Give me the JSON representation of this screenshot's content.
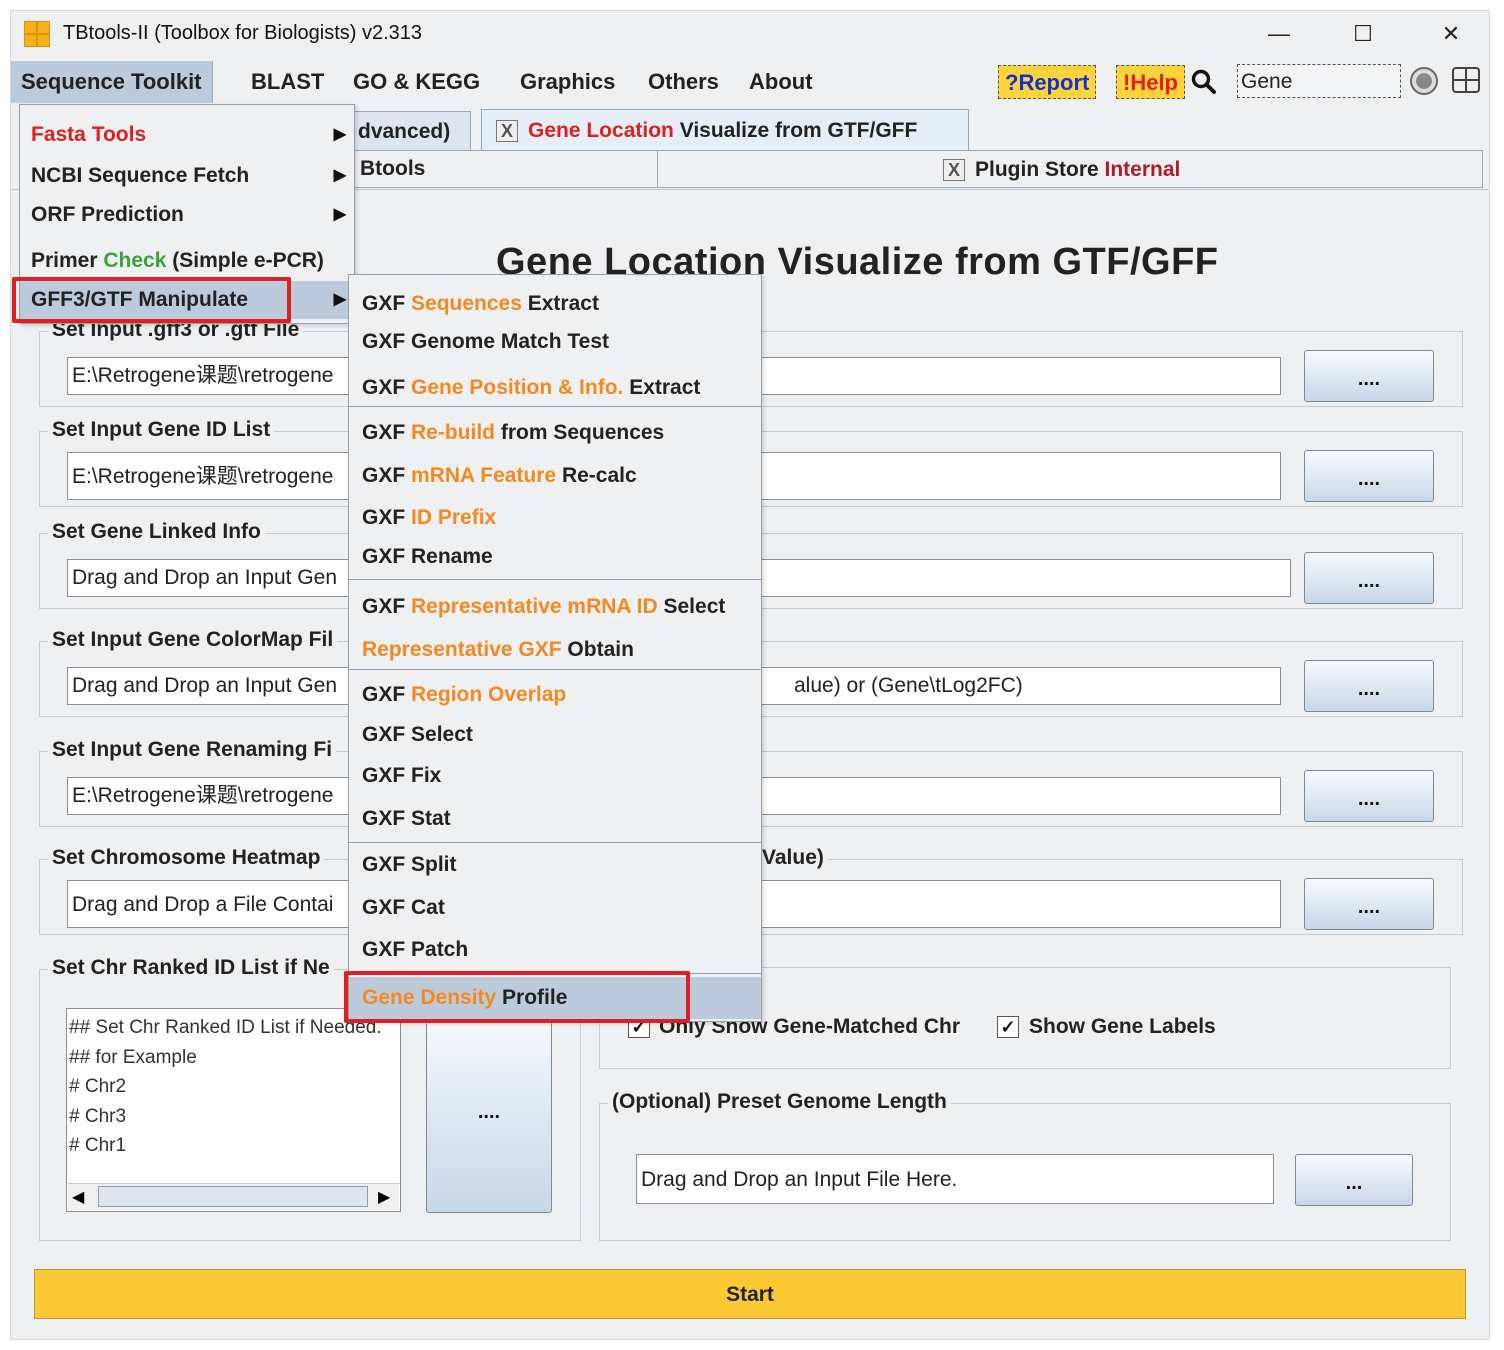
{
  "window": {
    "title": "TBtools-II (Toolbox for Biologists) v2.313",
    "minimize_glyph": "—",
    "maximize_glyph": "☐",
    "close_glyph": "✕"
  },
  "menubar": {
    "items": [
      "Sequence Toolkit",
      "BLAST",
      "GO & KEGG",
      "Graphics",
      "Others",
      "About"
    ],
    "report_label": "?Report",
    "help_label": "!Help",
    "search_value": "Gene"
  },
  "tabs": {
    "tab_advanced": "dvanced)",
    "tab_gene_location_a": "Gene Location",
    "tab_gene_location_b": " Visualize from GTF/GFF",
    "tab_tbtools": "Btools",
    "tab_plugin_a": "Plugin Store ",
    "tab_plugin_b": "Internal",
    "close_glyph": "X"
  },
  "panel": {
    "title": "Gene Location Visualize from GTF/GFF",
    "fields": [
      {
        "label": "Set Input .gff3 or .gtf File",
        "value": "E:\\Retrogene课题\\retrogene",
        "right_value": "",
        "button": "...."
      },
      {
        "label": "Set Input Gene ID List",
        "value": "E:\\Retrogene课题\\retrogene",
        "right_value": "",
        "button": "...."
      },
      {
        "label": "Set Gene Linked Info",
        "value": "Drag and Drop an Input Gen",
        "right_value": "",
        "button": "...."
      },
      {
        "label": "Set Input Gene ColorMap Fil",
        "value": "Drag and Drop an Input Gen",
        "right_value": "alue) or (Gene\\tLog2FC)",
        "button": "...."
      },
      {
        "label": "Set Input Gene Renaming Fi",
        "value": "E:\\Retrogene课题\\retrogene",
        "right_value": "",
        "button": "...."
      },
      {
        "label": "Set Chromosome Heatmap",
        "label_right": "Value)",
        "value": "Drag and Drop a File Contai",
        "right_value": "",
        "button": "...."
      }
    ],
    "chr_ranked_label": "Set Chr Ranked ID List if Ne",
    "chr_ranked_lines": [
      "## Set Chr Ranked ID List if Needed.",
      "## for Example",
      "# Chr2",
      "# Chr3",
      "# Chr1"
    ],
    "chr_ranked_button": "....",
    "options": {
      "only_matched_label": "Only Show Gene-Matched Chr",
      "show_labels_label": "Show Gene Labels",
      "check_glyph": "✓"
    },
    "preset": {
      "label": "(Optional) Preset Genome Length",
      "placeholder": "Drag and Drop an Input File Here.",
      "button": "..."
    },
    "start_label": "Start"
  },
  "menu_sequence_toolkit": {
    "items": [
      {
        "a": "Fasta Tools",
        "b": "",
        "c": ""
      },
      {
        "a": "NCBI Sequence Fetch",
        "b": "",
        "c": ""
      },
      {
        "a": "ORF Prediction",
        "b": "",
        "c": ""
      },
      {
        "a": "Primer ",
        "b": "Check",
        "c": " (Simple e-PCR)"
      },
      {
        "a": "GFF3/GTF Manipulate",
        "b": "",
        "c": ""
      }
    ]
  },
  "menu_gff": {
    "items": [
      {
        "a": "GXF ",
        "b": "Sequences",
        "c": " Extract"
      },
      {
        "a": "GXF Genome Match Test",
        "b": "",
        "c": ""
      },
      {
        "a": "GXF ",
        "b": "Gene Position & Info.",
        "c": " Extract"
      },
      {
        "a": "GXF ",
        "b": "Re-build",
        "c": " from Sequences"
      },
      {
        "a": "GXF ",
        "b": "mRNA Feature",
        "c": " Re-calc"
      },
      {
        "a": "GXF ",
        "b": "ID Prefix",
        "c": ""
      },
      {
        "a": "GXF Rename",
        "b": "",
        "c": ""
      },
      {
        "a": "GXF ",
        "b": "Representative mRNA ID",
        "c": " Select"
      },
      {
        "a": "",
        "b": "Representative GXF",
        "c": " Obtain"
      },
      {
        "a": "GXF ",
        "b": "Region Overlap",
        "c": ""
      },
      {
        "a": "GXF Select",
        "b": "",
        "c": ""
      },
      {
        "a": "GXF Fix",
        "b": "",
        "c": ""
      },
      {
        "a": "GXF Stat",
        "b": "",
        "c": ""
      },
      {
        "a": "GXF Split",
        "b": "",
        "c": ""
      },
      {
        "a": "GXF Cat",
        "b": "",
        "c": ""
      },
      {
        "a": "GXF Patch",
        "b": "",
        "c": ""
      },
      {
        "a": "",
        "b": "Gene Density",
        "c": " Profile"
      }
    ]
  },
  "icons": {
    "search": "search-icon",
    "settings": "circle-icon",
    "layout": "window-grid-icon",
    "submenu_arrow": "▶"
  }
}
